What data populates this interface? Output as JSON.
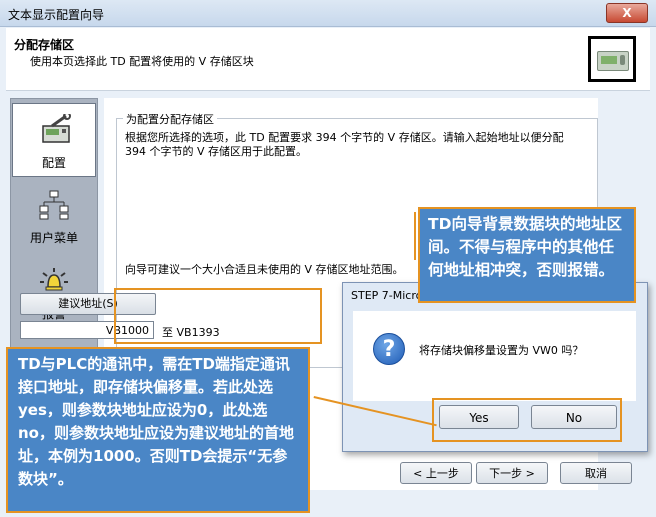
{
  "window": {
    "title": "文本显示配置向导",
    "close_glyph": "X"
  },
  "header": {
    "title": "分配存储区",
    "subtitle": "使用本页选择此 TD 配置将使用的 V 存储区块"
  },
  "sidebar": {
    "items": [
      {
        "label": "配置",
        "icon": "wrench-device-icon",
        "selected": true
      },
      {
        "label": "用户菜单",
        "icon": "tree-menu-icon",
        "selected": false
      },
      {
        "label": "报警",
        "icon": "alarm-bell-icon",
        "selected": false
      }
    ]
  },
  "group": {
    "title": "为配置分配存储区",
    "description": "根据您所选择的选项，此 TD 配置要求 394 个字节的 V 存储区。请输入起始地址以便分配 394 个字节的 V 存储区用于此配置。",
    "suggest_text": "向导可建议一个大小合适且未使用的 V 存储区地址范围。"
  },
  "suggest_button": "建议地址(S)",
  "address": {
    "value": "VB1000",
    "to_label": "至 VB1393"
  },
  "nav": {
    "prev": "< 上一步",
    "next": "下一步 >",
    "cancel": "取消"
  },
  "dialog": {
    "title": "STEP 7-Micro/WIN",
    "message": "将存储块偏移量设置为 VW0 吗？",
    "yes": "Yes",
    "no": "No",
    "icon": "question-icon"
  },
  "annotations": {
    "top": "TD向导背景数据块的地址区间。不得与程序中的其他任何地址相冲突，否则报错。",
    "bottom": "TD与PLC的通讯中，需在TD端指定通讯接口地址，即存储块偏移量。若此处选yes，则参数块地址应设为0，此处选no，则参数块地址应设为建议地址的首地址，本例为1000。否则TD会提示“无参数块”。"
  },
  "colors": {
    "annotation_fill": "#4a86c6",
    "annotation_border": "#e59322"
  }
}
